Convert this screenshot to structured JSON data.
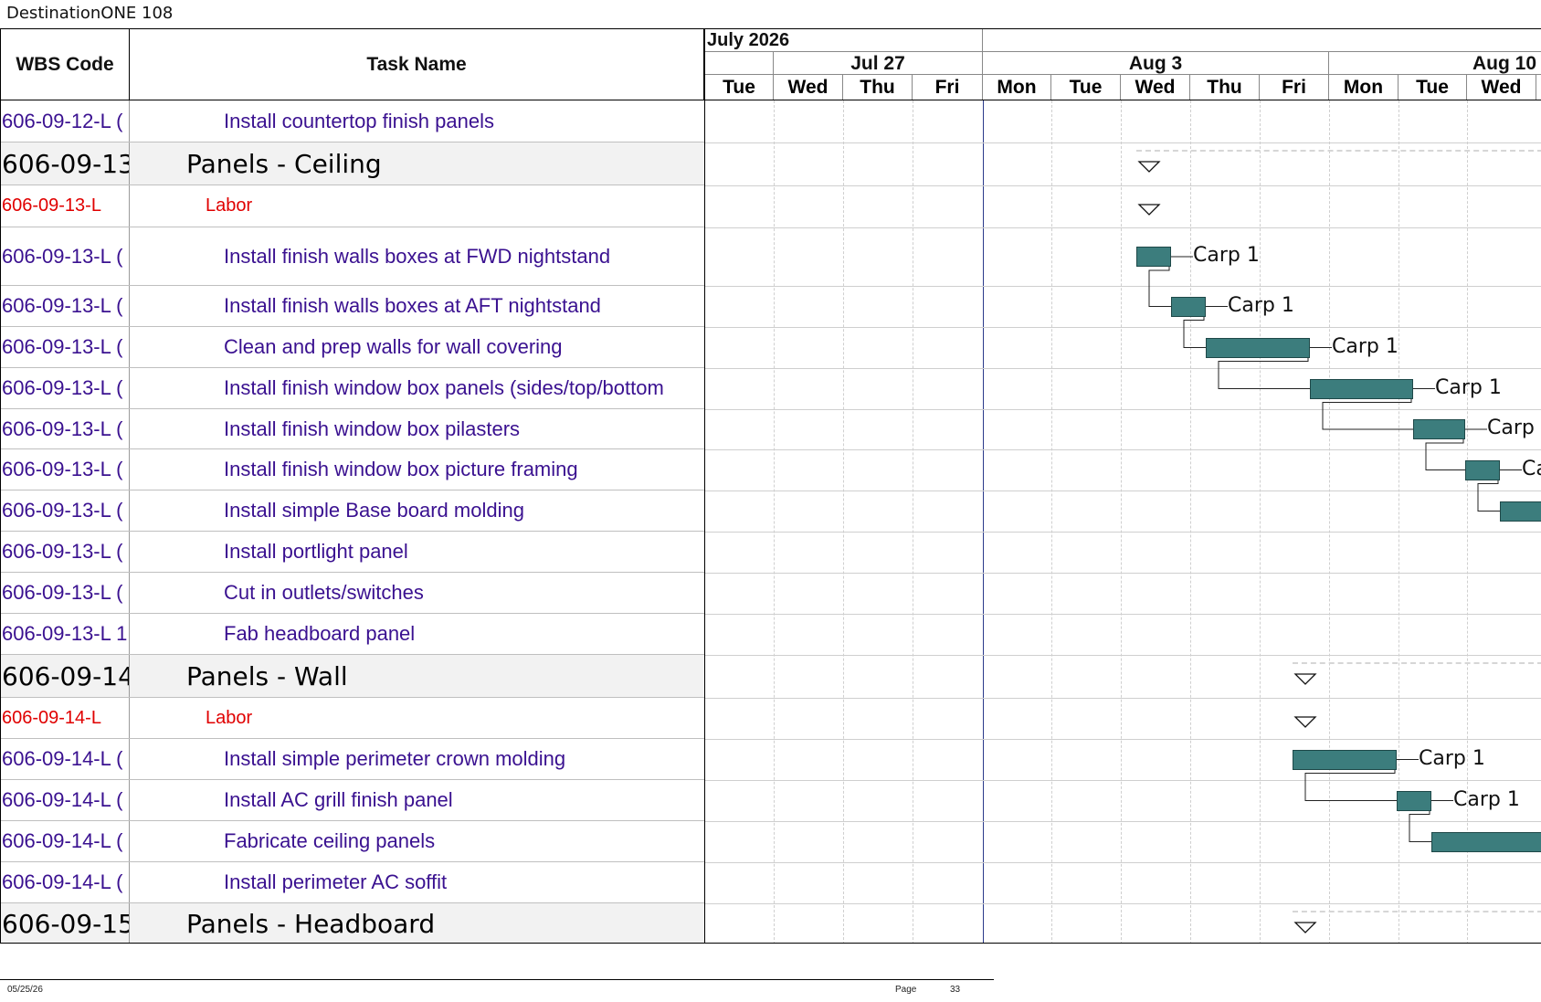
{
  "window": {
    "title": "DestinationONE 108"
  },
  "table": {
    "headers": {
      "wbs": "WBS Code",
      "task": "Task Name"
    },
    "rows": [
      {
        "type": "task",
        "wbs": "606-09-12-L (",
        "name": "Install countertop finish panels"
      },
      {
        "type": "summary",
        "wbs": "606-09-13",
        "name": "Panels - Ceiling"
      },
      {
        "type": "labor",
        "wbs": "606-09-13-L",
        "name": "Labor"
      },
      {
        "type": "task",
        "wbs": "606-09-13-L (",
        "name": "Install finish walls boxes at FWD nightstand"
      },
      {
        "type": "task",
        "wbs": "606-09-13-L (",
        "name": "Install finish walls boxes at AFT nightstand"
      },
      {
        "type": "task",
        "wbs": "606-09-13-L (",
        "name": "Clean and prep walls for wall covering"
      },
      {
        "type": "task",
        "wbs": "606-09-13-L (",
        "name": "Install finish window box panels (sides/top/bottom"
      },
      {
        "type": "task",
        "wbs": "606-09-13-L (",
        "name": "Install finish window box pilasters"
      },
      {
        "type": "task",
        "wbs": "606-09-13-L (",
        "name": "Install finish window box picture framing"
      },
      {
        "type": "task",
        "wbs": "606-09-13-L (",
        "name": "Install simple Base board molding"
      },
      {
        "type": "task",
        "wbs": "606-09-13-L (",
        "name": "Install portlight panel"
      },
      {
        "type": "task",
        "wbs": "606-09-13-L (",
        "name": "Cut in outlets/switches"
      },
      {
        "type": "task",
        "wbs": "606-09-13-L 1",
        "name": "Fab headboard panel"
      },
      {
        "type": "summary",
        "wbs": "606-09-14",
        "name": "Panels - Wall"
      },
      {
        "type": "labor",
        "wbs": "606-09-14-L",
        "name": "Labor"
      },
      {
        "type": "task",
        "wbs": "606-09-14-L (",
        "name": "Install simple perimeter crown molding"
      },
      {
        "type": "task",
        "wbs": "606-09-14-L (",
        "name": "Install AC grill finish panel"
      },
      {
        "type": "task",
        "wbs": "606-09-14-L (",
        "name": "Fabricate ceiling panels"
      },
      {
        "type": "task",
        "wbs": "606-09-14-L (",
        "name": "Install perimeter AC soffit"
      },
      {
        "type": "summary",
        "wbs": "606-09-15",
        "name": "Panels - Headboard"
      }
    ]
  },
  "gantt": {
    "month": "July 2026",
    "weeks": [
      "Jul 27",
      "Aug 3",
      "Aug 10"
    ],
    "days": [
      "Tue",
      "Wed",
      "Thu",
      "Fri",
      "Mon",
      "Tue",
      "Wed",
      "Thu",
      "Fri",
      "Mon",
      "Tue",
      "Wed"
    ],
    "resource_label": "Carp 1",
    "bar_color": "#3c7d7d"
  },
  "footer": {
    "date": "05/25/26",
    "page_label": "Page",
    "page_number": "33"
  }
}
